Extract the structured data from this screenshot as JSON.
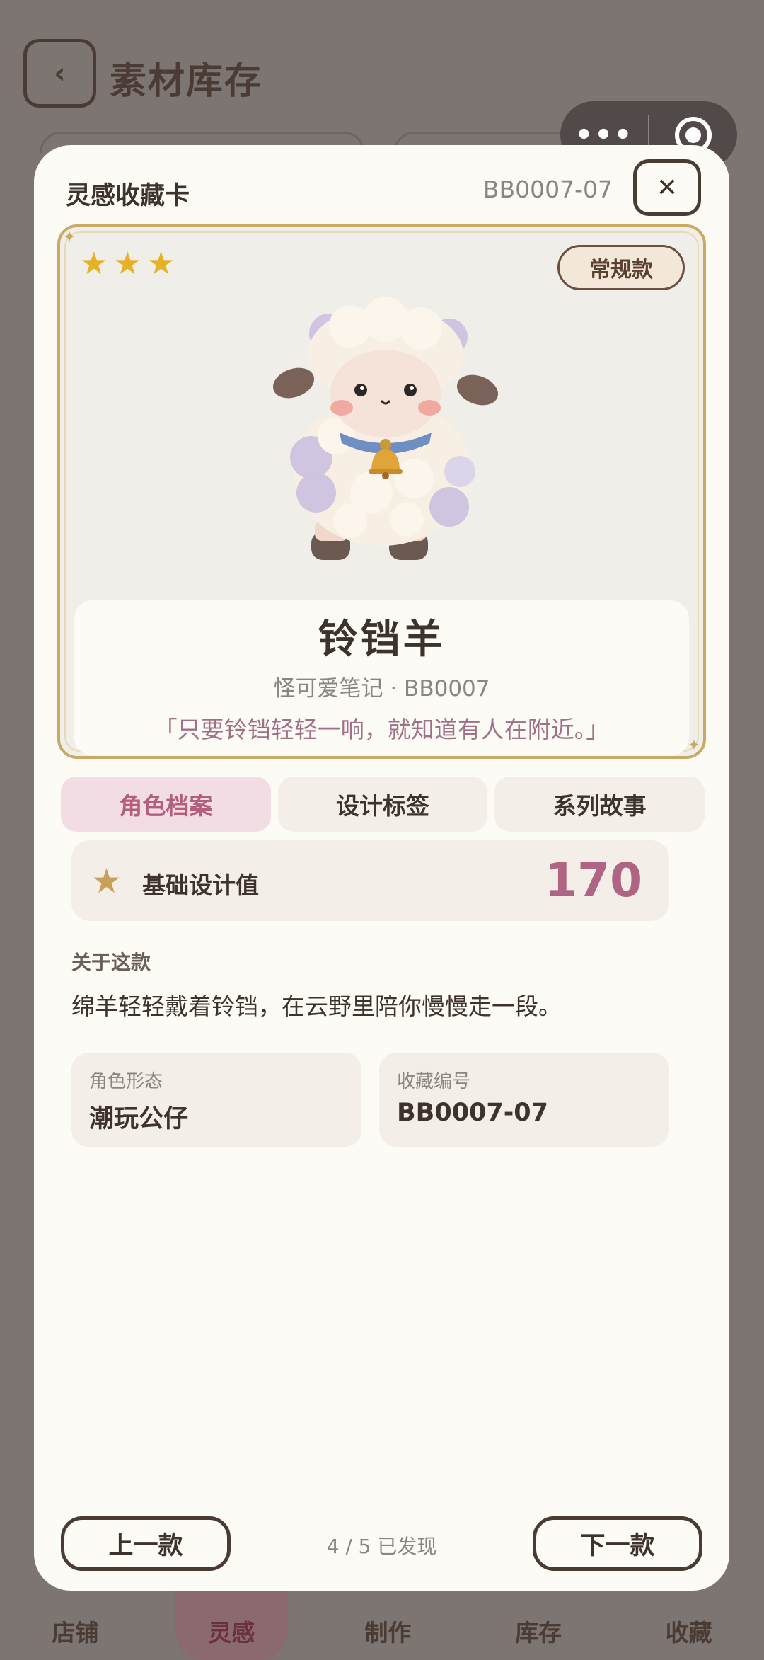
{
  "background": {
    "title": "素材库存",
    "capsule": {
      "more_label": "•••"
    },
    "tabbar": [
      "店铺",
      "灵感",
      "制作",
      "库存",
      "收藏"
    ],
    "active_tab_index": 1
  },
  "modal": {
    "title": "灵感收藏卡",
    "code": "BB0007-07",
    "close_label": "✕",
    "card": {
      "stars": 3,
      "edition": "常规款",
      "name": "铃铛羊",
      "subtitle": "怪可爱笔记 · BB0007",
      "quote": "「只要铃铛轻轻一响，就知道有人在附近。」"
    },
    "tabs": [
      "角色档案",
      "设计标签",
      "系列故事"
    ],
    "active_tab_index": 0,
    "stat": {
      "label": "基础设计值",
      "value": "170"
    },
    "about": {
      "label": "关于这款",
      "text": "绵羊轻轻戴着铃铛，在云野里陪你慢慢走一段。"
    },
    "fields": [
      {
        "label": "角色形态",
        "value": "潮玩公仔"
      },
      {
        "label": "收藏编号",
        "value": "BB0007-07"
      }
    ],
    "footer": {
      "prev_label": "上一款",
      "next_label": "下一款",
      "progress": "4 / 5 已发现"
    }
  },
  "colors": {
    "accent_pink": "#b06484",
    "gold_border": "#c9a964",
    "star": "#e6b027"
  }
}
